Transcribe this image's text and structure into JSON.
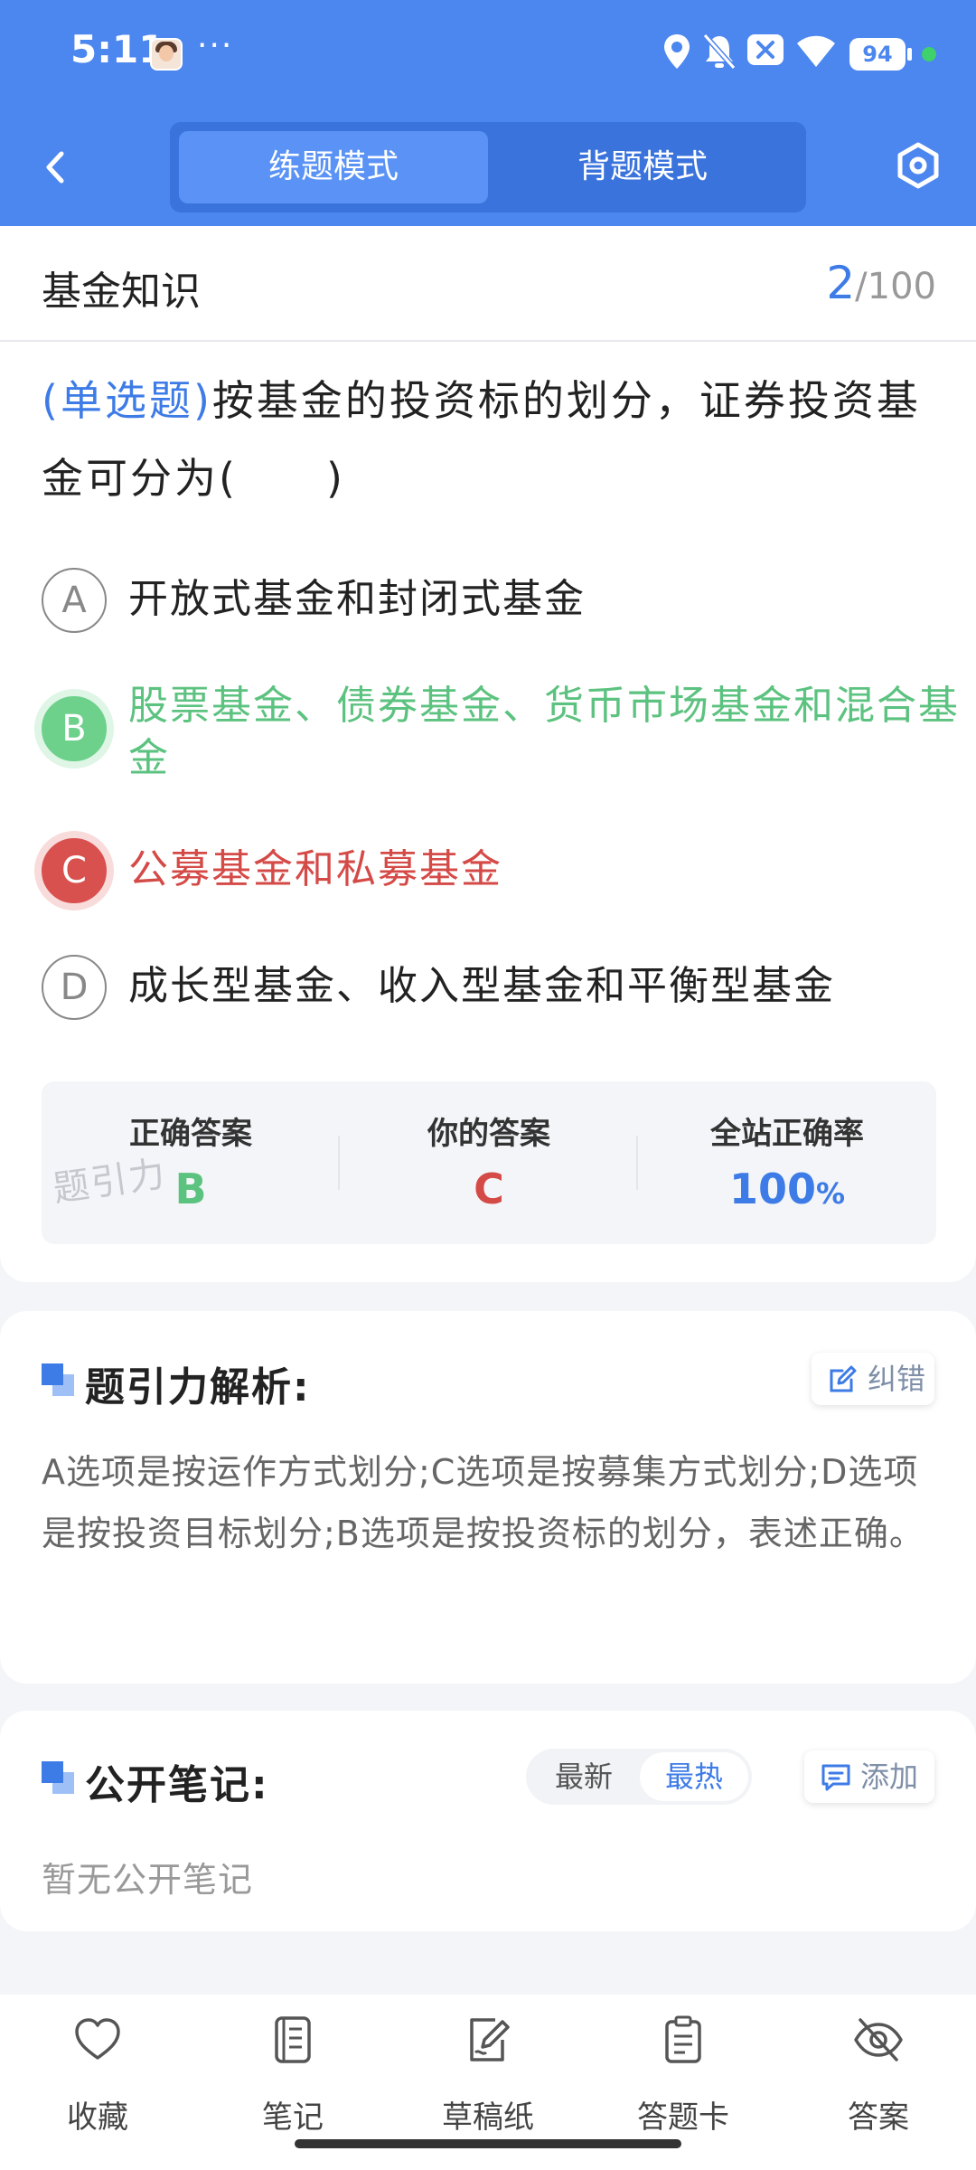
{
  "status_bar": {
    "time": "5:11",
    "more": "···",
    "battery": "94"
  },
  "header": {
    "modes": [
      "练题模式",
      "背题模式"
    ],
    "active_mode": "练题模式"
  },
  "question_card": {
    "subject": "基金知识",
    "current": "2",
    "total": "/100",
    "question_type": "(单选题)",
    "question_text": "按基金的投资标的划分，证券投资基金可分为(　　)",
    "options": [
      {
        "letter": "A",
        "text": "开放式基金和封闭式基金",
        "state": "normal"
      },
      {
        "letter": "B",
        "text": "股票基金、债券基金、货币市场基金和混合基金",
        "state": "correct"
      },
      {
        "letter": "C",
        "text": "公募基金和私募基金",
        "state": "wrong"
      },
      {
        "letter": "D",
        "text": "成长型基金、收入型基金和平衡型基金",
        "state": "normal"
      }
    ],
    "result": {
      "correct_label": "正确答案",
      "correct_value": "B",
      "yours_label": "你的答案",
      "yours_value": "C",
      "rate_label": "全站正确率",
      "rate_value": "100",
      "rate_unit": "%",
      "watermark": "题引力"
    }
  },
  "analysis": {
    "title": "题引力解析:",
    "correction_button": "纠错",
    "text": "A选项是按运作方式划分;C选项是按募集方式划分;D选项是按投资目标划分;B选项是按投资标的划分，表述正确。"
  },
  "notes": {
    "title": "公开笔记:",
    "sort_options": [
      "最新",
      "最热"
    ],
    "active_sort": "最热",
    "add_button": "添加",
    "empty_text": "暂无公开笔记"
  },
  "bottom_nav": [
    {
      "label": "收藏",
      "icon": "heart-icon"
    },
    {
      "label": "笔记",
      "icon": "notebook-icon"
    },
    {
      "label": "草稿纸",
      "icon": "draft-icon"
    },
    {
      "label": "答题卡",
      "icon": "answer-sheet-icon"
    },
    {
      "label": "答案",
      "icon": "eye-off-icon"
    }
  ],
  "colors": {
    "brand": "#4c86ef",
    "accent_text": "#3d7be6",
    "correct": "#5cc27f",
    "wrong": "#d44a47"
  }
}
